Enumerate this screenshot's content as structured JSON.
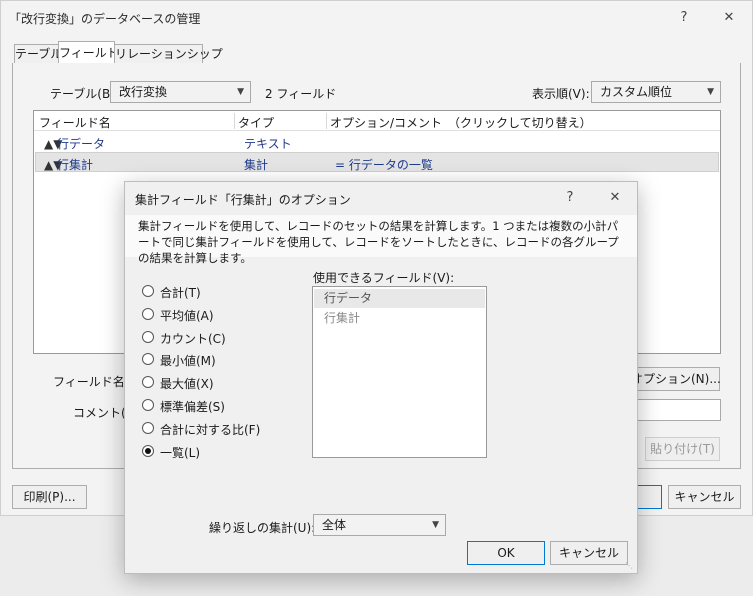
{
  "window": {
    "title": "「改行変換」のデータベースの管理",
    "help": "?",
    "close": "✕"
  },
  "tabs": [
    {
      "label": "テーブル"
    },
    {
      "label": "フィールド"
    },
    {
      "label": "リレーションシップ"
    }
  ],
  "fields_tab": {
    "table_label": "テーブル(B):",
    "table_value": "改行変換",
    "field_count": "2 フィールド",
    "sort_label": "表示順(V):",
    "sort_value": "カスタム順位",
    "columns": [
      "フィールド名",
      "タイプ",
      "オプション/コメント　（クリックして切り替え）"
    ],
    "rows": [
      {
        "name": "行データ",
        "type": "テキスト",
        "option": ""
      },
      {
        "name": "行集計",
        "type": "集計",
        "option": "= 行データの一覧"
      }
    ],
    "field_name_label": "フィールド名(F):",
    "comment_label": "コメント(C):",
    "options_button": "オプション(N)...",
    "paste_button": "貼り付け(T)",
    "print_button": "印刷(P)...",
    "cancel_button": "キャンセル"
  },
  "dialog": {
    "title": "集計フィールド「行集計」のオプション",
    "help": "?",
    "close": "✕",
    "description": "集計フィールドを使用して、レコードのセットの結果を計算します。1 つまたは複数の小計パートで同じ集計フィールドを使用して、レコードをソートしたときに、レコードの各グループの結果を計算します。",
    "radio_options": [
      {
        "label": "合計(T)",
        "checked": false
      },
      {
        "label": "平均値(A)",
        "checked": false
      },
      {
        "label": "カウント(C)",
        "checked": false
      },
      {
        "label": "最小値(M)",
        "checked": false
      },
      {
        "label": "最大値(X)",
        "checked": false
      },
      {
        "label": "標準偏差(S)",
        "checked": false
      },
      {
        "label": "合計に対する比(F)",
        "checked": false
      },
      {
        "label": "一覧(L)",
        "checked": true
      }
    ],
    "available_label": "使用できるフィールド(V):",
    "available_fields": [
      "行データ",
      "行集計"
    ],
    "repeat_label": "繰り返しの集計(U):",
    "repeat_value": "全体",
    "ok_button": "OK",
    "cancel_button": "キャンセル"
  },
  "icons": {
    "dropdown": "chevron-down-icon",
    "drag_handle": "drag-handle-icon",
    "radio_checked": "radio-checked-icon",
    "resize_grip": "resize-grip-icon"
  },
  "colors": {
    "accent_border": "#0078d4",
    "field_text": "#1f3a8a",
    "selected_row": "#e4e4e4"
  }
}
